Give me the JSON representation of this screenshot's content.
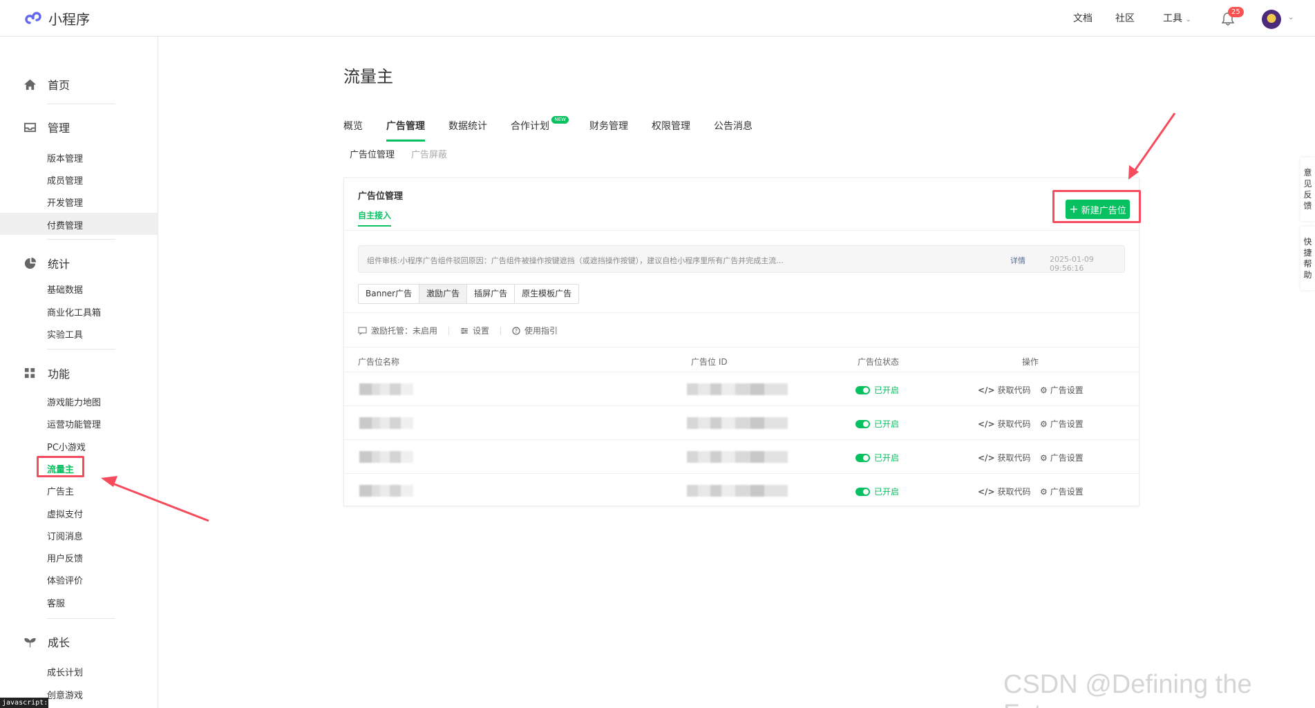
{
  "app": {
    "title": "小程序"
  },
  "topnav": {
    "docs": "文档",
    "community": "社区",
    "tools": "工具",
    "notifications": "25"
  },
  "sidebar": {
    "home": "首页",
    "manage": {
      "label": "管理",
      "items": [
        "版本管理",
        "成员管理",
        "开发管理",
        "付费管理"
      ]
    },
    "stats": {
      "label": "统计",
      "items": [
        "基础数据",
        "商业化工具箱",
        "实验工具"
      ]
    },
    "features": {
      "label": "功能",
      "items": [
        "游戏能力地图",
        "运营功能管理",
        "PC小游戏",
        "流量主",
        "广告主",
        "虚拟支付",
        "订阅消息",
        "用户反馈",
        "体验评价",
        "客服"
      ]
    },
    "growth": {
      "label": "成长",
      "items": [
        "成长计划",
        "创意游戏"
      ]
    }
  },
  "statusbar": "javascript:;",
  "page": {
    "title": "流量主",
    "tabs": [
      "概览",
      "广告管理",
      "数据统计",
      "合作计划",
      "财务管理",
      "权限管理",
      "公告消息"
    ],
    "new_tag": "NEW",
    "subtabs": [
      "广告位管理",
      "广告屏蔽"
    ]
  },
  "card": {
    "title": "广告位管理",
    "subtab": "自主接入",
    "new_button": "新建广告位",
    "notice": {
      "message": "组件审核:小程序广告组件驳回原因：广告组件被操作按键遮挡（或遮挡操作按键），建议自检小程序里所有广告并完成主流...",
      "detail": "详情",
      "time": "2025-01-09 09:56:16"
    },
    "ad_types": [
      "Banner广告",
      "激励广告",
      "插屏广告",
      "原生模板广告"
    ],
    "toolbar": {
      "incentive": "激励托管：未启用",
      "settings": "设置",
      "guide": "使用指引"
    },
    "columns": [
      "广告位名称",
      "广告位 ID",
      "广告位状态",
      "操作"
    ],
    "rows": [
      {
        "status": "已开启",
        "get_code": "获取代码",
        "ad_settings": "广告设置"
      },
      {
        "status": "已开启",
        "get_code": "获取代码",
        "ad_settings": "广告设置"
      },
      {
        "status": "已开启",
        "get_code": "获取代码",
        "ad_settings": "广告设置"
      },
      {
        "status": "已开启",
        "get_code": "获取代码",
        "ad_settings": "广告设置"
      }
    ]
  },
  "side_float": {
    "feedback": "意见反馈",
    "help": "快捷帮助"
  },
  "watermark": "CSDN @Defining the Future",
  "colors": {
    "accent": "#07c160",
    "highlight": "#f54b5c"
  }
}
